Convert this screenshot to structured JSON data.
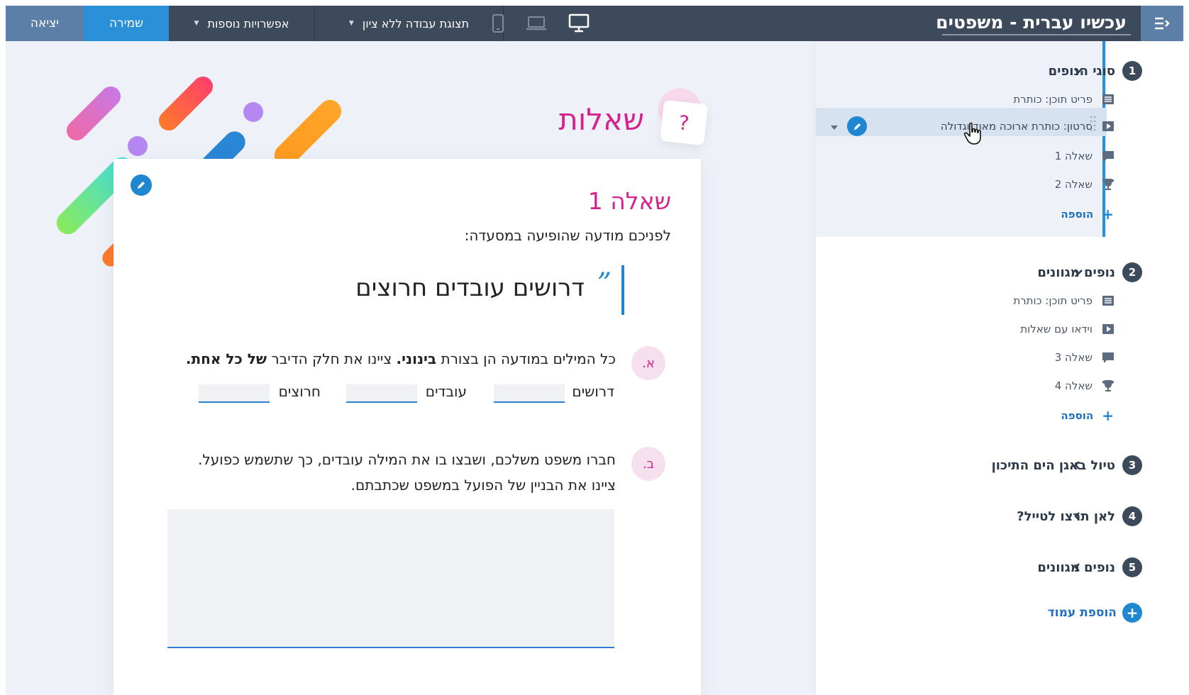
{
  "topbar": {
    "title": "עכשיו עברית - משפטים",
    "exit_label": "יציאה",
    "save_label": "שמירה",
    "more_options_label": "אפשרויות נוספות",
    "view_label": "תצוגת עבודה ללא ציון",
    "devices": [
      "mobile-icon",
      "laptop-icon",
      "desktop-icon"
    ],
    "active_device": "desktop"
  },
  "page": {
    "title": "שאלות",
    "badge_symbol": "?"
  },
  "question": {
    "title": "שאלה 1",
    "intro": "לפניכם מודעה שהופיעה במסעדה:",
    "quote_mark": "”",
    "quote": "דרושים עובדים חרוצים",
    "part_a": {
      "letter": "א.",
      "text_1": "כל המילים במודעה הן בצורת ",
      "text_bold_1": "בינוני.",
      "text_2": " ציינו את חלק הדיבר ",
      "text_bold_2": "של כל אחת.",
      "blanks": [
        "דרושים",
        "עובדים",
        "חרוצים"
      ]
    },
    "part_b": {
      "letter": "ב.",
      "line_1": "חברו משפט משלכם, ושבצו בו את המילה עובדים, כך שתשמש כפועל.",
      "line_2": "ציינו את הבניין של הפועל במשפט שכתבתם."
    }
  },
  "sidebar": {
    "sections": [
      {
        "number": "1",
        "title": "סוגי הנופים",
        "expanded": true,
        "items": [
          {
            "icon": "content-item-icon",
            "label": "פריט תוכן: כותרת"
          },
          {
            "icon": "video-icon",
            "label": "סרטון: כותרת ארוכה מאוד וגדולה",
            "selected": true
          },
          {
            "icon": "comment-icon",
            "label": "שאלה 1"
          },
          {
            "icon": "trophy-icon",
            "label": "שאלה 2"
          }
        ],
        "add_label": "הוספה"
      },
      {
        "number": "2",
        "title": "נופים מגוונים",
        "expanded": true,
        "items": [
          {
            "icon": "content-item-icon",
            "label": "פריט תוכן: כותרת"
          },
          {
            "icon": "video-icon",
            "label": "וידאו עם שאלות"
          },
          {
            "icon": "comment-icon",
            "label": "שאלה 3"
          },
          {
            "icon": "trophy-icon",
            "label": "שאלה 4"
          }
        ],
        "add_label": "הוספה"
      },
      {
        "number": "3",
        "title": "טיול באגן הים התיכון",
        "expanded": false
      },
      {
        "number": "4",
        "title": "לאן תרצו לטייל?",
        "expanded": false
      },
      {
        "number": "5",
        "title": "נופים מגוונים",
        "expanded": false
      }
    ],
    "add_page_label": "הוספת עמוד"
  },
  "colors": {
    "accent": "#1f86d1",
    "brand_pink": "#d5228f",
    "topbar": "#3d4a5c"
  }
}
